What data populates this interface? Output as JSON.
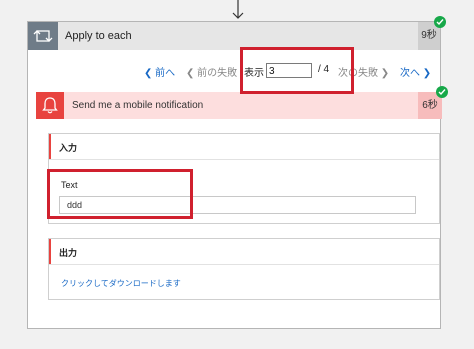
{
  "loop": {
    "title": "Apply to each",
    "duration": "9秒",
    "status_color": "#17a849"
  },
  "pager": {
    "prev": "前へ",
    "prev_failed": "前の失敗",
    "show": "表示",
    "current_page": "3",
    "total": "/ 4",
    "next_failed": "次の失敗",
    "next": "次へ"
  },
  "action": {
    "title": "Send me a mobile notification",
    "duration": "6秒",
    "icon": "bell-icon",
    "accent_color": "#e8433f"
  },
  "inputs": {
    "heading": "入力",
    "field_label": "Text",
    "field_value": "ddd"
  },
  "outputs": {
    "heading": "出力",
    "download_link": "クリックしてダウンロードします"
  },
  "colors": {
    "highlight_red": "#d0202e",
    "link_blue": "#1768c5"
  }
}
